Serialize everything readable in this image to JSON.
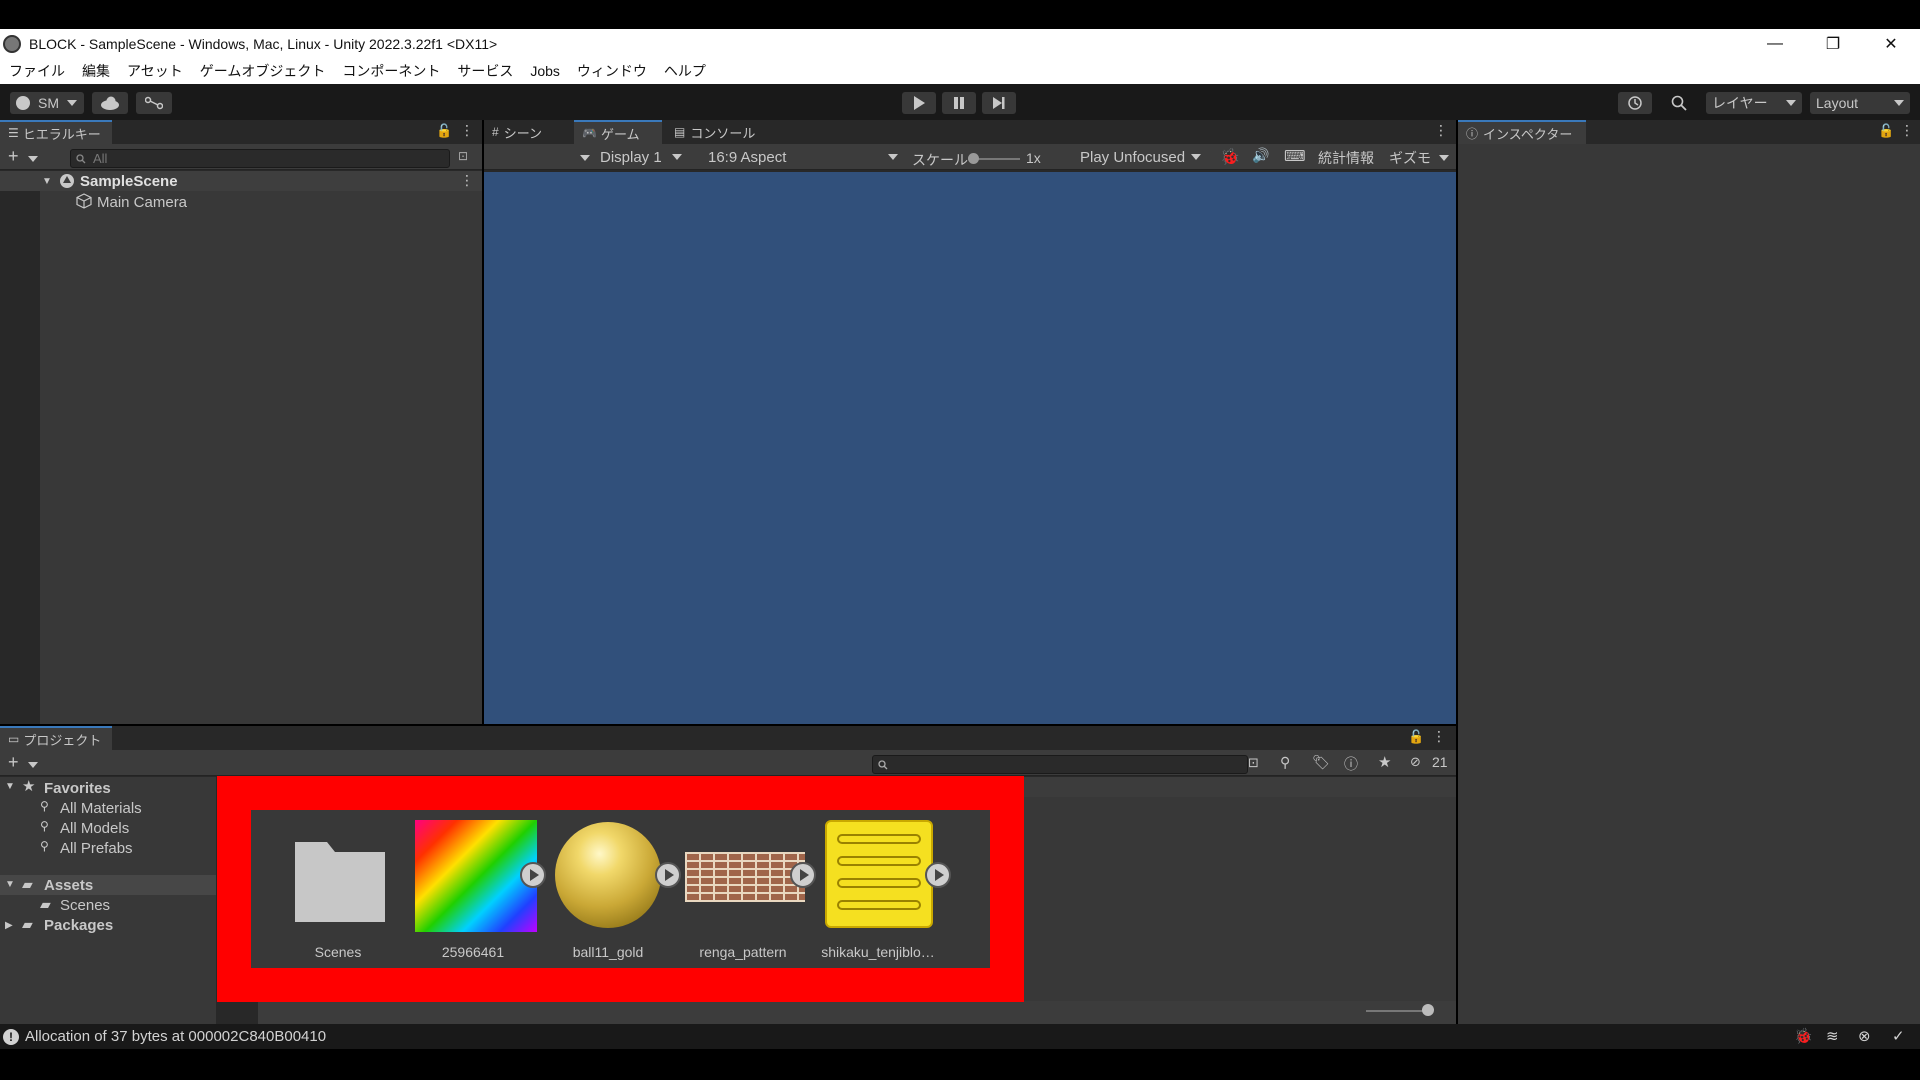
{
  "window": {
    "title": "BLOCK - SampleScene - Windows, Mac, Linux - Unity 2022.3.22f1 <DX11>",
    "minimize": "—",
    "restore": "❐",
    "close": "✕"
  },
  "menu": [
    "ファイル",
    "編集",
    "アセット",
    "ゲームオブジェクト",
    "コンポーネント",
    "サービス",
    "Jobs",
    "ウィンドウ",
    "ヘルプ"
  ],
  "toolbar": {
    "account": "SM",
    "layers": "レイヤー",
    "layout": "Layout"
  },
  "hierarchy": {
    "tab": "ヒエラルキー",
    "search_placeholder": "All",
    "scene": "SampleScene",
    "objects": [
      "Main Camera"
    ]
  },
  "game": {
    "tabs": [
      "シーン",
      "ゲーム",
      "コンソール"
    ],
    "active_tab": "ゲーム",
    "display": "Display 1",
    "aspect": "16:9 Aspect",
    "scale_label": "スケール",
    "scale_value": "1x",
    "play_mode": "Play Unfocused",
    "stats": "統計情報",
    "gizmos": "ギズモ",
    "background": "#31507b"
  },
  "inspector": {
    "tab": "インスペクター"
  },
  "project": {
    "tab": "プロジェクト",
    "hidden_count": "21",
    "tree": {
      "favorites": "Favorites",
      "favorite_items": [
        "All Materials",
        "All Models",
        "All Prefabs"
      ],
      "assets": "Assets",
      "asset_children": [
        "Scenes"
      ],
      "packages": "Packages"
    },
    "assets": [
      {
        "label": "Scenes",
        "kind": "folder"
      },
      {
        "label": "25966461",
        "kind": "texture-rainbow"
      },
      {
        "label": "ball11_gold",
        "kind": "texture-gold-ball"
      },
      {
        "label": "renga_pattern",
        "kind": "texture-brick"
      },
      {
        "label": "shikaku_tenjiblo…",
        "kind": "texture-yellow-block"
      }
    ],
    "highlight_color": "#ff0000"
  },
  "status": {
    "message": "Allocation of 37 bytes at 000002C840B00410"
  }
}
